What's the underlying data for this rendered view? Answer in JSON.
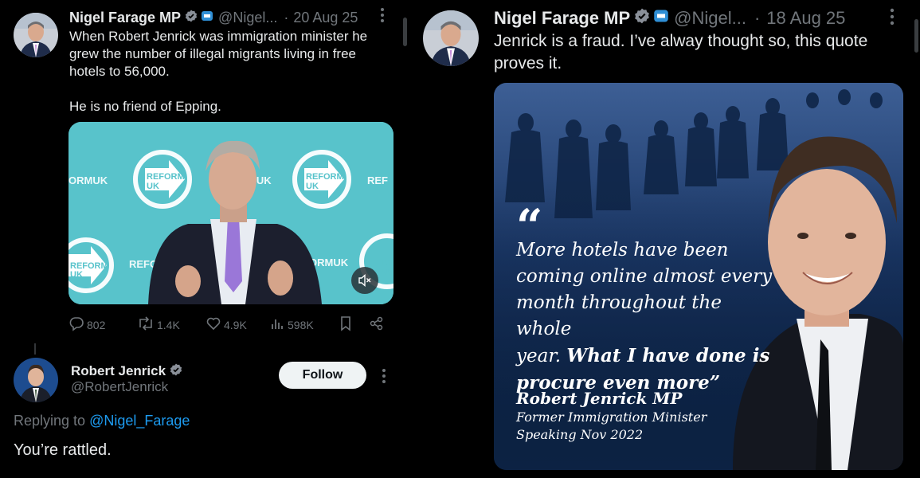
{
  "tweet_left": {
    "author_name": "Nigel Farage MP",
    "handle": "@Nigel...",
    "separator": "·",
    "date": "20 Aug 25",
    "text_lines": [
      "When Robert Jenrick was immigration minister he",
      "grew the number of illegal migrants living in free",
      "hotels to 56,000.",
      "",
      "He is no friend of Epping."
    ],
    "video_banner_texts": [
      "ORMUK",
      "REFORM",
      "UK",
      "MUK",
      "REFORM",
      "UK",
      "REF",
      "REFORM",
      "UK",
      "REFO",
      "ORMUK",
      "RE",
      "UK"
    ],
    "actions": {
      "replies": "802",
      "reposts": "1.4K",
      "likes": "4.9K",
      "views": "598K"
    }
  },
  "reply": {
    "author_name": "Robert Jenrick",
    "handle": "@RobertJenrick",
    "follow_label": "Follow",
    "replying_to_prefix": "Replying to ",
    "replying_to_handle": "@Nigel_Farage",
    "text": "You’re rattled."
  },
  "tweet_right": {
    "author_name": "Nigel Farage MP",
    "handle": "@Nigel...",
    "separator": "·",
    "date": "18 Aug 25",
    "text_lines": [
      "Jenrick is a fraud. I’ve alway thought so, this quote",
      "proves it."
    ],
    "image": {
      "quote_mark": "“",
      "quote_lines_plain": [
        "More hotels have been",
        "coming online almost every",
        "month throughout the whole",
        "year."
      ],
      "quote_bold_1": "What I have done is",
      "quote_bold_2": "procure even more”",
      "attribution_name": "Robert Jenrick MP",
      "attribution_role": "Former Immigration Minister",
      "attribution_date": "Speaking Nov 2022"
    }
  },
  "colors": {
    "background": "#000000",
    "text": "#e7e9ea",
    "muted": "#71767b",
    "accent_link": "#1d9bf0",
    "verified_gold": "#e2b719",
    "verified_blue": "#1d9bf0",
    "video_teal": "#3fc0c8",
    "quote_bg": "#0c2344"
  },
  "icons": [
    "verified-badge-icon",
    "affiliate-badge-icon",
    "more-icon",
    "reply-icon",
    "repost-icon",
    "like-icon",
    "views-icon",
    "bookmark-icon",
    "share-icon",
    "mute-icon"
  ]
}
